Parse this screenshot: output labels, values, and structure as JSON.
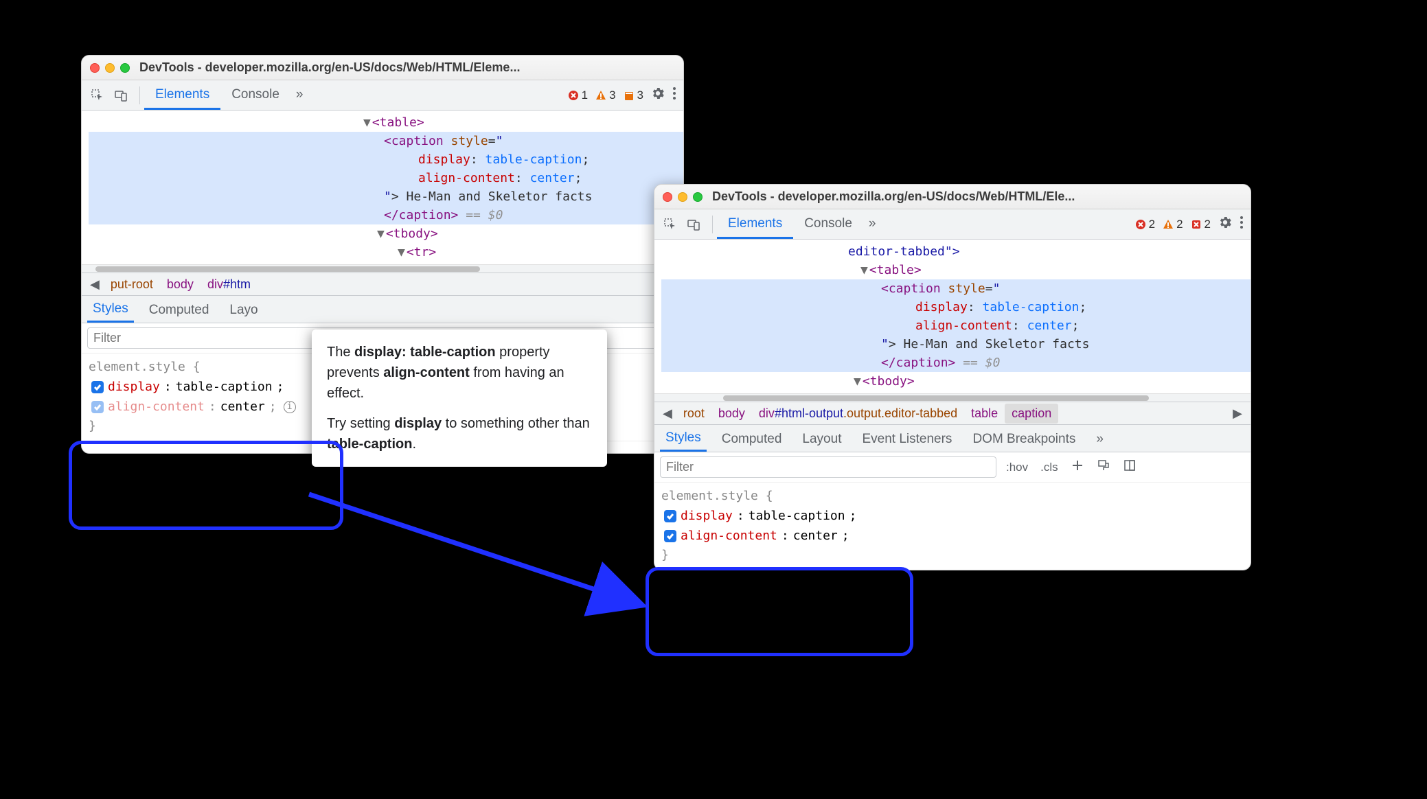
{
  "left_window": {
    "title": "DevTools - developer.mozilla.org/en-US/docs/Web/HTML/Eleme...",
    "tabs": {
      "elements": "Elements",
      "console": "Console",
      "more": "»"
    },
    "badges": {
      "error": "1",
      "warn": "3",
      "info": "3"
    },
    "dom": {
      "table_open": "<table>",
      "caption_open": "<caption",
      "style_attr": "style",
      "eq": "=",
      "q": "\"",
      "prop1_name": "display",
      "prop1_val": "table-caption",
      "prop2_name": "align-content",
      "prop2_val": "center",
      "caption_text": "He-Man and Skeletor facts",
      "caption_close": "</caption>",
      "eq0": " == ",
      "sel0": "$0",
      "tbody_open": "<tbody>",
      "tr_open": "<tr>"
    },
    "breadcrumb": {
      "trunc": "put-root",
      "body": "body",
      "div": "div#htm"
    },
    "subtabs": {
      "styles": "Styles",
      "computed": "Computed",
      "layout": "Layo"
    },
    "filter_placeholder": "Filter",
    "styles": {
      "selector": "element.style {",
      "p1_name": "display",
      "p1_val": "table-caption",
      "p2_name": "align-content",
      "p2_val": "center",
      "close": "}"
    },
    "tooltip": {
      "line1a": "The ",
      "line1b": "display: table-caption",
      "line1c": " property prevents ",
      "line1d": "align-content",
      "line1e": " from having an effect.",
      "line2a": "Try setting ",
      "line2b": "display",
      "line2c": " to something other than ",
      "line2d": "table-caption",
      "line2e": "."
    }
  },
  "right_window": {
    "title": "DevTools - developer.mozilla.org/en-US/docs/Web/HTML/Ele...",
    "tabs": {
      "elements": "Elements",
      "console": "Console",
      "more": "»"
    },
    "badges": {
      "error": "2",
      "warn": "2",
      "other": "2"
    },
    "dom": {
      "editor_tabbed": "editor-tabbed\">",
      "table_open": "<table>",
      "caption_open": "<caption",
      "style_attr": "style",
      "eq": "=",
      "q": "\"",
      "prop1_name": "display",
      "prop1_val": "table-caption",
      "prop2_name": "align-content",
      "prop2_val": "center",
      "caption_text": "He-Man and Skeletor facts",
      "caption_close": "</caption>",
      "eq0": " == ",
      "sel0": "$0",
      "tbody_open": "<tbody>"
    },
    "breadcrumb": {
      "root": "root",
      "body": "body",
      "div": "div#html-output.output.editor-tabbed",
      "table": "table",
      "caption": "caption"
    },
    "subtabs": {
      "styles": "Styles",
      "computed": "Computed",
      "layout": "Layout",
      "events": "Event Listeners",
      "dom": "DOM Breakpoints",
      "more": "»"
    },
    "filter_placeholder": "Filter",
    "toolbar_small": {
      "hov": ":hov",
      "cls": ".cls"
    },
    "styles": {
      "selector": "element.style {",
      "p1_name": "display",
      "p1_val": "table-caption",
      "p2_name": "align-content",
      "p2_val": "center",
      "close": "}"
    }
  }
}
